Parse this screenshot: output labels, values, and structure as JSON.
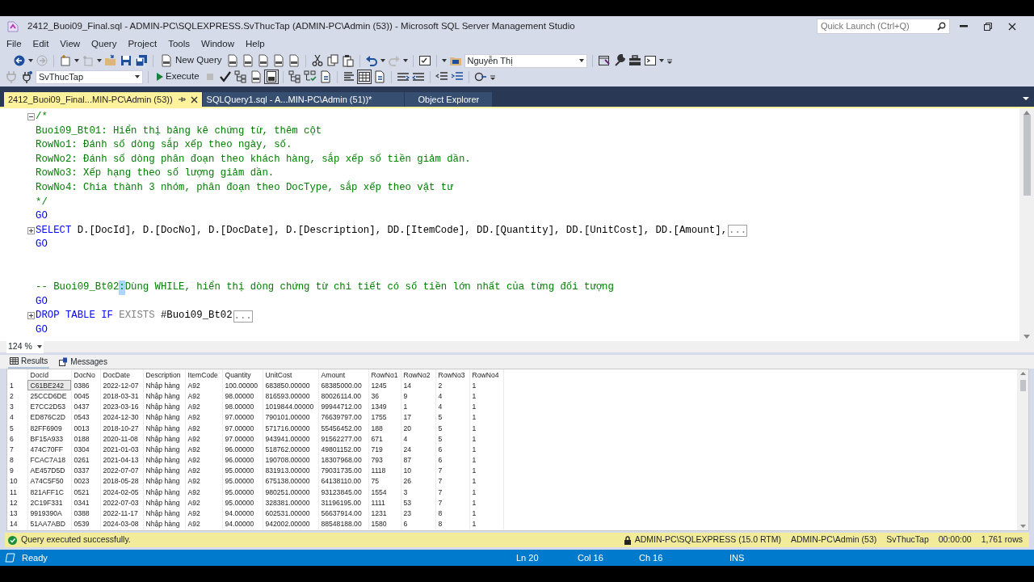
{
  "window": {
    "title": "2412_Buoi09_Final.sql - ADMIN-PC\\SQLEXPRESS.SvThucTap (ADMIN-PC\\Admin (53)) - Microsoft SQL Server Management Studio",
    "quick_launch": {
      "placeholder": "Quick Launch (Ctrl+Q)"
    }
  },
  "menu": [
    "File",
    "Edit",
    "View",
    "Query",
    "Project",
    "Tools",
    "Window",
    "Help"
  ],
  "toolbar": {
    "new_query": "New Query",
    "user_combo": "Nguyễn Thị",
    "database_combo": "SvThucTap",
    "execute": "Execute"
  },
  "tabs": [
    {
      "label": "2412_Buoi09_Final...MIN-PC\\Admin (53))",
      "selected": true
    },
    {
      "label": "SQLQuery1.sql - A...MIN-PC\\Admin (51))*",
      "selected": false
    },
    {
      "label": "Object Explorer",
      "selected": false
    }
  ],
  "editor": {
    "lines": [
      {
        "kind": "block_start",
        "tokens": [
          {
            "kind": "comment",
            "text": "/*"
          }
        ]
      },
      {
        "kind": "code",
        "tokens": [
          {
            "kind": "comment",
            "text": "Buoi09_Bt01: Hiển thị bảng kê chứng từ, thêm cột"
          }
        ]
      },
      {
        "kind": "code",
        "tokens": [
          {
            "kind": "comment",
            "text": "RowNo1: Đánh số dòng sắp xếp theo ngày, số."
          }
        ]
      },
      {
        "kind": "code",
        "tokens": [
          {
            "kind": "comment",
            "text": "RowNo2: Đánh số dòng phân đoạn theo khách hàng, sắp xếp số tiền giảm dần."
          }
        ]
      },
      {
        "kind": "code",
        "tokens": [
          {
            "kind": "comment",
            "text": "RowNo3: Xếp hạng theo số lượng giảm dần."
          }
        ]
      },
      {
        "kind": "code",
        "tokens": [
          {
            "kind": "comment",
            "text": "RowNo4: Chia thành 3 nhóm, phân đoạn theo DocType, sắp xếp theo vật tư"
          }
        ]
      },
      {
        "kind": "code",
        "tokens": [
          {
            "kind": "comment",
            "text": "*/"
          }
        ]
      },
      {
        "kind": "code",
        "tokens": [
          {
            "kind": "keyword",
            "text": "GO"
          }
        ]
      },
      {
        "kind": "folded",
        "tokens": [
          {
            "kind": "keyword",
            "text": "SELECT"
          },
          {
            "kind": "plain",
            "text": " D.[DocId], D.[DocNo], D.[DocDate], D.[Description], DD.[ItemCode], DD.[Quantity], DD.[UnitCost], DD.[Amount],"
          },
          {
            "kind": "collapsed",
            "text": "..."
          }
        ]
      },
      {
        "kind": "code",
        "tokens": [
          {
            "kind": "keyword",
            "text": "GO"
          }
        ]
      },
      {
        "kind": "blank"
      },
      {
        "kind": "blank"
      },
      {
        "kind": "code",
        "tokens": [
          {
            "kind": "comment",
            "text": "-- Buoi09_Bt02"
          },
          {
            "kind": "selection",
            "text": ":"
          },
          {
            "kind": "comment",
            "text": "Dùng WHILE, hiển thị dòng chứng từ chi tiết có số tiền lớn nhất của từng đối tượng"
          }
        ]
      },
      {
        "kind": "code",
        "tokens": [
          {
            "kind": "keyword",
            "text": "GO"
          }
        ]
      },
      {
        "kind": "folded",
        "tokens": [
          {
            "kind": "keyword",
            "text": "DROP TABLE IF"
          },
          {
            "kind": "operator",
            "text": " EXISTS"
          },
          {
            "kind": "plain",
            "text": " #Buoi09_Bt02"
          },
          {
            "kind": "collapsed",
            "text": "..."
          }
        ]
      },
      {
        "kind": "code",
        "tokens": [
          {
            "kind": "keyword",
            "text": "GO"
          }
        ]
      }
    ],
    "zoom": "124 %"
  },
  "results": {
    "tabs": [
      {
        "label": "Results",
        "selected": true
      },
      {
        "label": "Messages",
        "selected": false
      }
    ],
    "columns": [
      "DocId",
      "DocNo",
      "DocDate",
      "Description",
      "ItemCode",
      "Quantity",
      "UnitCost",
      "Amount",
      "RowNo1",
      "RowNo2",
      "RowNo3",
      "RowNo4"
    ],
    "rows": [
      {
        "number": "1",
        "selected": true,
        "cells": [
          "C61BE242",
          "0386",
          "2022-12-07",
          "Nhập hàng",
          "A92",
          "100.00000",
          "683850.00000",
          "68385000.00",
          "1245",
          "14",
          "2",
          "1"
        ]
      },
      {
        "number": "2",
        "selected": false,
        "cells": [
          "25CCD6DE",
          "0045",
          "2018-03-31",
          "Nhập hàng",
          "A92",
          "98.00000",
          "816593.00000",
          "80026114.00",
          "36",
          "9",
          "4",
          "1"
        ]
      },
      {
        "number": "3",
        "selected": false,
        "cells": [
          "E7CC2D53",
          "0437",
          "2023-03-16",
          "Nhập hàng",
          "A92",
          "98.00000",
          "1019844.00000",
          "99944712.00",
          "1349",
          "1",
          "4",
          "1"
        ]
      },
      {
        "number": "4",
        "selected": false,
        "cells": [
          "ED876C2D",
          "0543",
          "2024-12-30",
          "Nhập hàng",
          "A92",
          "97.00000",
          "790101.00000",
          "76639797.00",
          "1755",
          "17",
          "5",
          "1"
        ]
      },
      {
        "number": "5",
        "selected": false,
        "cells": [
          "82FF6909",
          "0013",
          "2018-10-27",
          "Nhập hàng",
          "A92",
          "97.00000",
          "571716.00000",
          "55456452.00",
          "188",
          "20",
          "5",
          "1"
        ]
      },
      {
        "number": "6",
        "selected": false,
        "cells": [
          "BF15A933",
          "0188",
          "2020-11-08",
          "Nhập hàng",
          "A92",
          "97.00000",
          "943941.00000",
          "91562277.00",
          "671",
          "4",
          "5",
          "1"
        ]
      },
      {
        "number": "7",
        "selected": false,
        "cells": [
          "474C70FF",
          "0304",
          "2021-01-03",
          "Nhập hàng",
          "A92",
          "96.00000",
          "518762.00000",
          "49801152.00",
          "719",
          "24",
          "6",
          "1"
        ]
      },
      {
        "number": "8",
        "selected": false,
        "cells": [
          "FCAC7A18",
          "0261",
          "2021-04-13",
          "Nhập hàng",
          "A92",
          "96.00000",
          "190708.00000",
          "18307968.00",
          "793",
          "87",
          "6",
          "1"
        ]
      },
      {
        "number": "9",
        "selected": false,
        "cells": [
          "AE457D5D",
          "0337",
          "2022-07-07",
          "Nhập hàng",
          "A92",
          "95.00000",
          "831913.00000",
          "79031735.00",
          "1118",
          "10",
          "7",
          "1"
        ]
      },
      {
        "number": "10",
        "selected": false,
        "cells": [
          "A74C5F50",
          "0023",
          "2018-05-28",
          "Nhập hàng",
          "A92",
          "95.00000",
          "675138.00000",
          "64138110.00",
          "75",
          "26",
          "7",
          "1"
        ]
      },
      {
        "number": "11",
        "selected": false,
        "cells": [
          "821AFF1C",
          "0521",
          "2024-02-05",
          "Nhập hàng",
          "A92",
          "95.00000",
          "980251.00000",
          "93123845.00",
          "1554",
          "3",
          "7",
          "1"
        ]
      },
      {
        "number": "12",
        "selected": false,
        "cells": [
          "2C19F331",
          "0341",
          "2022-07-03",
          "Nhập hàng",
          "A92",
          "95.00000",
          "328381.00000",
          "31196195.00",
          "1111",
          "53",
          "7",
          "1"
        ]
      },
      {
        "number": "13",
        "selected": false,
        "cells": [
          "9919390A",
          "0388",
          "2022-11-17",
          "Nhập hàng",
          "A92",
          "94.00000",
          "602531.00000",
          "56637914.00",
          "1231",
          "23",
          "8",
          "1"
        ]
      },
      {
        "number": "14",
        "selected": false,
        "cells": [
          "51AA7ABD",
          "0539",
          "2024-03-08",
          "Nhập hàng",
          "A92",
          "94.00000",
          "942002.00000",
          "88548188.00",
          "1580",
          "6",
          "8",
          "1"
        ]
      }
    ]
  },
  "query_status": {
    "message": "Query executed successfully.",
    "server": "ADMIN-PC\\SQLEXPRESS (15.0 RTM)",
    "login": "ADMIN-PC\\Admin (53)",
    "database": "SvThucTap",
    "elapsed": "00:00:00",
    "rows": "1,761 rows"
  },
  "status_bar": {
    "state": "Ready",
    "line": "Ln 20",
    "column": "Col 16",
    "char": "Ch 16",
    "mode": "INS"
  }
}
